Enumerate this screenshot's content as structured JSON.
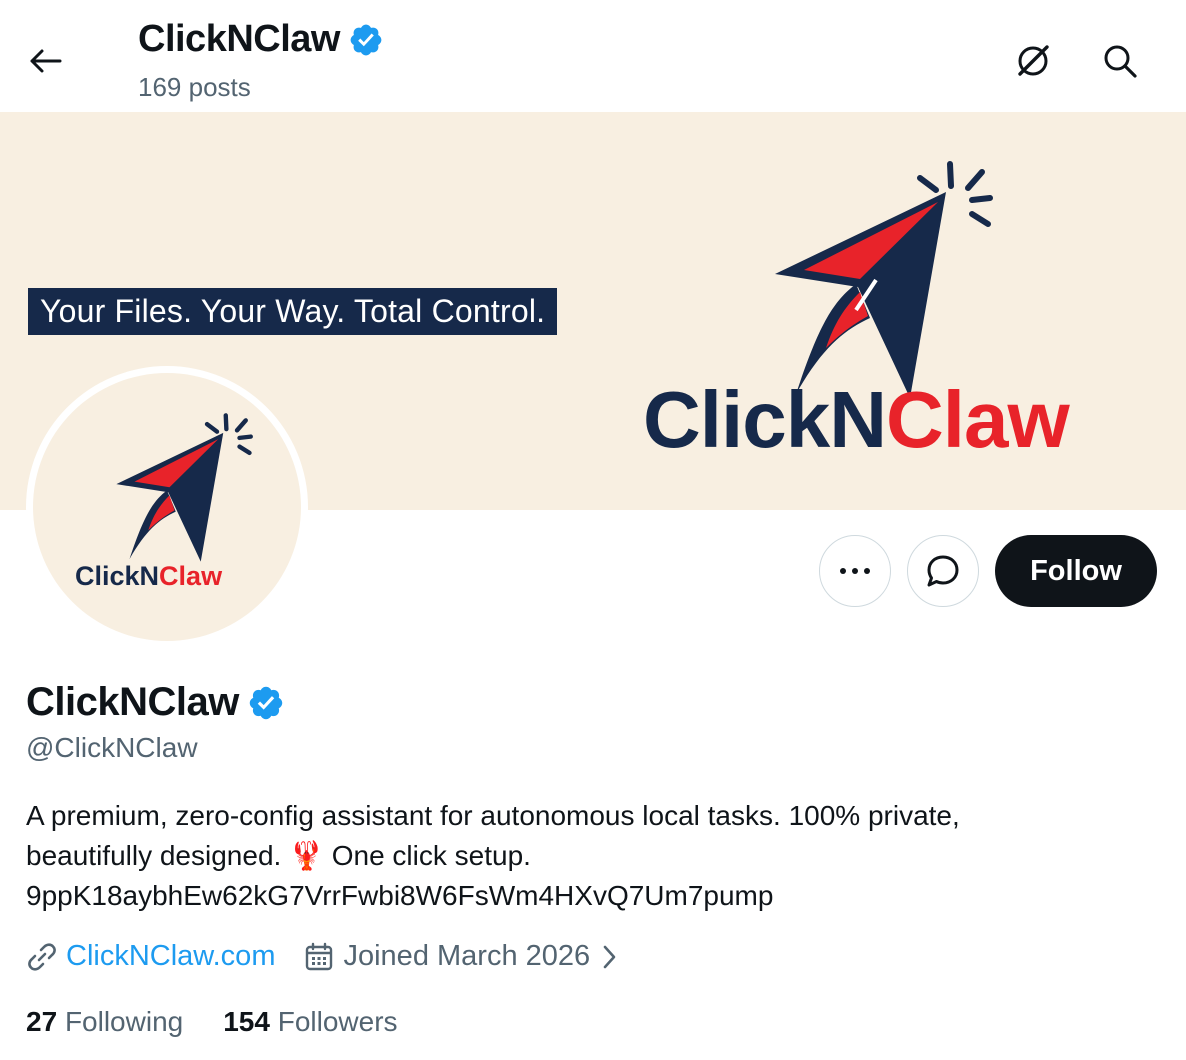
{
  "header": {
    "title": "ClickNClaw",
    "posts": "169 posts"
  },
  "banner": {
    "tagline": "Your Files. Your Way. Total Control.",
    "wordmark_left": "ClickN",
    "wordmark_right": "Claw"
  },
  "avatar": {
    "wordmark_left": "ClickN",
    "wordmark_right": "Claw"
  },
  "actions": {
    "more_icon": "ellipsis-icon",
    "message_icon": "message-icon",
    "follow_label": "Follow"
  },
  "profile": {
    "display_name": "ClickNClaw",
    "handle": "@ClickNClaw",
    "bio_line1": "A premium, zero-config assistant for autonomous local tasks. 100% private,",
    "bio_line2_pre": "beautifully designed. ",
    "bio_emoji": "🦞",
    "bio_line2_post": " One click setup.",
    "bio_line3": "9ppK18aybhEw62kG7VrrFwbi8W6FsWm4HXvQ7Um7pump",
    "website": "ClickNClaw.com",
    "joined": "Joined March 2026"
  },
  "stats": {
    "following_count": "27",
    "following_label": "Following",
    "followers_count": "154",
    "followers_label": "Followers"
  },
  "colors": {
    "brand_navy": "#16294a",
    "brand_red": "#e8232a",
    "banner_bg": "#f8efe1",
    "verified": "#1d9bf0",
    "secondary_text": "#536471"
  }
}
